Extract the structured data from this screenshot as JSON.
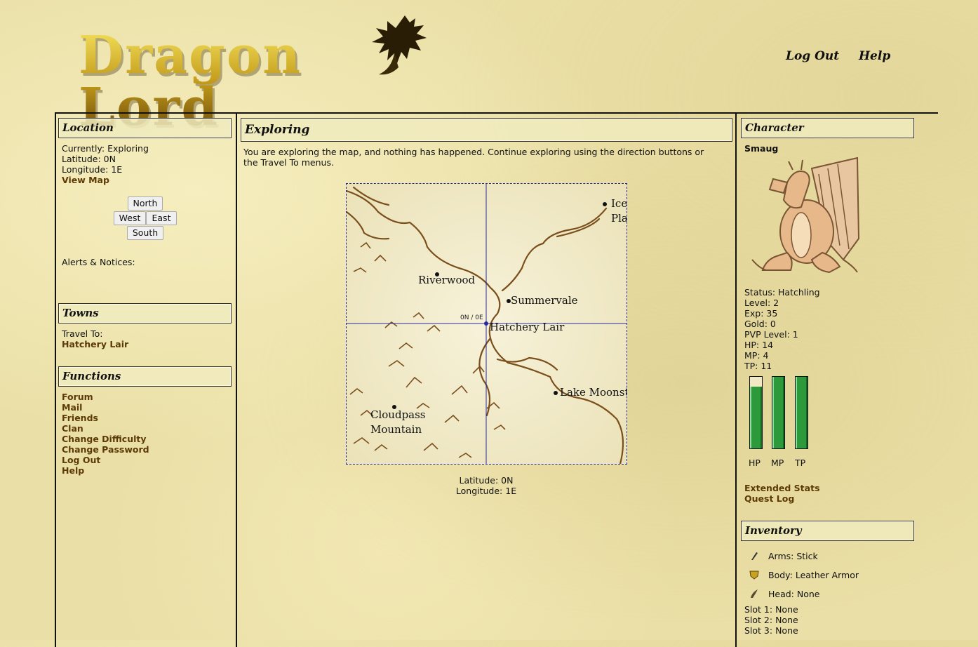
{
  "header": {
    "logo_text": "Dragon Lord",
    "logout_link": "Log Out",
    "help_link": "Help"
  },
  "left": {
    "location": {
      "title": "Location",
      "currently": "Currently: Exploring",
      "latitude": "Latitude: 0N",
      "longitude": "Longitude: 1E",
      "view_map": "View Map"
    },
    "directions": {
      "north": "North",
      "west": "West",
      "east": "East",
      "south": "South"
    },
    "alerts_label": "Alerts & Notices:",
    "towns": {
      "title": "Towns",
      "travel_to_label": "Travel To:",
      "destinations": [
        "Hatchery Lair"
      ]
    },
    "functions": {
      "title": "Functions",
      "links": [
        "Forum",
        "Mail",
        "Friends",
        "Clan",
        "Change Difficulty",
        "Change Password",
        "Log Out",
        "Help"
      ]
    }
  },
  "main": {
    "title": "Exploring",
    "message": "You are exploring the map, and nothing has happened. Continue exploring using the direction buttons or the Travel To menus.",
    "map": {
      "places": [
        "Riverwood",
        "Summervale",
        "Hatchery Lair",
        "Cloudpass",
        "Mountain",
        "Lake Moonst",
        "Ice",
        "Pla"
      ],
      "crosshair_label": "0N / 0E"
    },
    "coords": {
      "latitude": "Latitude: 0N",
      "longitude": "Longitude: 1E"
    }
  },
  "right": {
    "character": {
      "title": "Character",
      "name": "Smaug",
      "status": "Status: Hatchling",
      "level": "Level: 2",
      "exp": "Exp: 35",
      "gold": "Gold: 0",
      "pvp_level": "PVP Level: 1",
      "hp": "HP: 14",
      "mp": "MP: 4",
      "tp": "TP: 11",
      "bars": {
        "hp_label": "HP",
        "hp_fill": 0.86,
        "mp_label": "MP",
        "mp_fill": 1.0,
        "tp_label": "TP",
        "tp_fill": 1.0
      },
      "extended_stats": "Extended Stats",
      "quest_log": "Quest Log"
    },
    "inventory": {
      "title": "Inventory",
      "arms": "Arms: Stick",
      "body": "Body: Leather Armor",
      "head": "Head: None",
      "slot1": "Slot 1: None",
      "slot2": "Slot 2: None",
      "slot3": "Slot 3: None"
    }
  },
  "colors": {
    "background": "#eadfa6",
    "link": "#5c3a06",
    "bar_green": "#2c9a3a",
    "grid_blue": "#2a2a9a"
  }
}
